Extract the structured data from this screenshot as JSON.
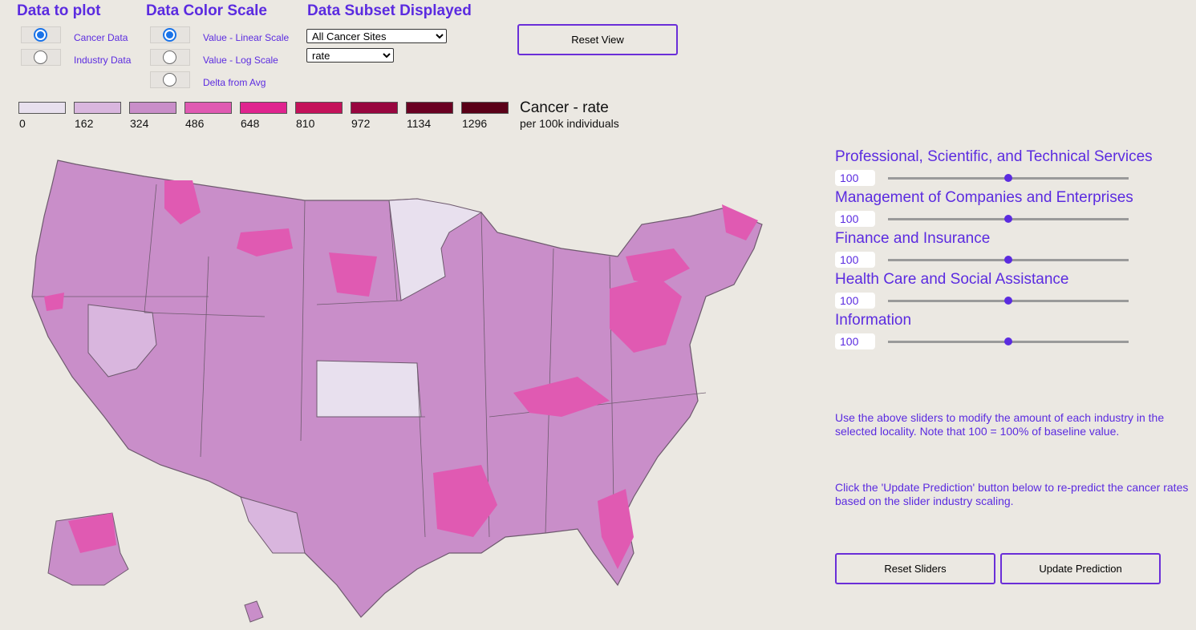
{
  "headers": {
    "data_to_plot": "Data to plot",
    "data_color_scale": "Data Color Scale",
    "data_subset": "Data Subset Displayed"
  },
  "data_to_plot": {
    "options": [
      {
        "label": "Cancer Data",
        "selected": true
      },
      {
        "label": "Industry Data",
        "selected": false
      }
    ]
  },
  "color_scale": {
    "options": [
      {
        "label": "Value - Linear Scale",
        "selected": true
      },
      {
        "label": "Value - Log Scale",
        "selected": false
      },
      {
        "label": "Delta from Avg",
        "selected": false
      }
    ]
  },
  "subset": {
    "site_select": "All Cancer Sites",
    "measure_select": "rate"
  },
  "buttons": {
    "reset_view": "Reset View",
    "reset_sliders": "Reset Sliders",
    "update_prediction": "Update Prediction"
  },
  "legend": {
    "title": "Cancer - rate",
    "subtitle": "per 100k individuals",
    "ticks": [
      "0",
      "162",
      "324",
      "486",
      "648",
      "810",
      "972",
      "1134",
      "1296"
    ],
    "colors": [
      "#e8e0ee",
      "#d9b6de",
      "#c98ec9",
      "#e05ab2",
      "#e0248f",
      "#c4125a",
      "#98063f",
      "#6a0022",
      "#5a0018"
    ]
  },
  "sliders": [
    {
      "label": "Professional, Scientific, and Technical Services",
      "value": "100",
      "fraction": 0.5
    },
    {
      "label": "Management of Companies and Enterprises",
      "value": "100",
      "fraction": 0.5
    },
    {
      "label": "Finance and Insurance",
      "value": "100",
      "fraction": 0.5
    },
    {
      "label": "Health Care and Social Assistance",
      "value": "100",
      "fraction": 0.5
    },
    {
      "label": "Information",
      "value": "100",
      "fraction": 0.5
    }
  ],
  "notes": {
    "sliders_help": "Use the above sliders to modify the amount of each industry in the selected locality. Note that 100 = 100% of baseline value.",
    "update_help": "Click the 'Update Prediction' button below to re-predict the cancer rates based on the slider industry scaling."
  },
  "map": {
    "base_color": "#c98ec9",
    "low_color": "#e8e0ee",
    "mid_color": "#d9b6de",
    "high_color": "#e05ab2",
    "border_color": "#6e5a6e"
  }
}
